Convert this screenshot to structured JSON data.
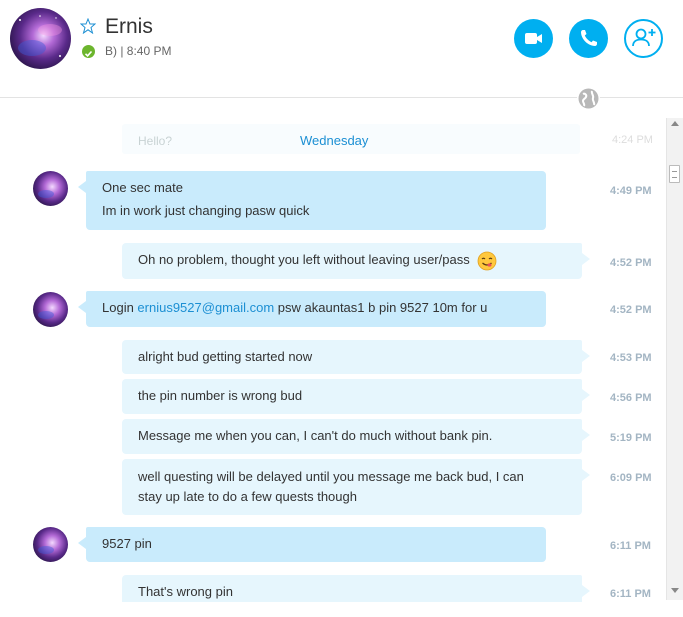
{
  "header": {
    "contact_name": "Ernis",
    "status_text": "B) | 8:40 PM",
    "status_color": "#6cb52d",
    "accent_color": "#00aff0",
    "buttons": {
      "video_icon": "video-camera-icon",
      "call_icon": "phone-icon",
      "add_icon": "add-person-icon"
    }
  },
  "conversation": {
    "faded_message": "Hello?",
    "faded_time": "4:24 PM",
    "day_separator": "Wednesday",
    "messages": [
      {
        "direction": "in",
        "lines": [
          "One sec mate",
          "Im in work just changing pasw quick"
        ],
        "time": "4:49 PM"
      },
      {
        "direction": "out",
        "lines": [
          "Oh no problem, thought you left without leaving user/pass"
        ],
        "emoji": "savoring-face-emoji",
        "time": "4:52 PM"
      },
      {
        "direction": "in",
        "prefix": "Login ",
        "link": "ernius9527@gmail.com",
        "suffix": " psw akauntas1 b pin 9527 10m for u",
        "time": "4:52 PM"
      },
      {
        "direction": "out",
        "lines": [
          "alright bud getting started now"
        ],
        "time": "4:53 PM"
      },
      {
        "direction": "out",
        "lines": [
          "the pin number is wrong bud"
        ],
        "time": "4:56 PM"
      },
      {
        "direction": "out",
        "lines": [
          "Message me when you can, I can't do much without bank pin."
        ],
        "time": "5:19 PM"
      },
      {
        "direction": "out",
        "lines": [
          "well questing will be delayed until you message me back bud, I can",
          "stay up late to do a few quests though"
        ],
        "time": "6:09 PM"
      },
      {
        "direction": "in",
        "lines": [
          "9527 pin"
        ],
        "time": "6:11 PM"
      },
      {
        "direction": "out",
        "lines": [
          "That's wrong pin"
        ],
        "time": "6:11 PM"
      }
    ]
  },
  "icons": {
    "favorite": "star-icon",
    "globe": "globe-icon"
  }
}
